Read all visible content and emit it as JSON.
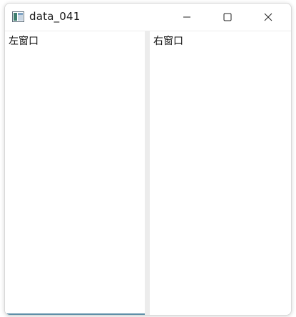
{
  "window": {
    "title": "data_041"
  },
  "titlebar": {
    "buttons": {
      "minimize": "minimize-icon",
      "maximize": "maximize-icon",
      "close": "close-icon"
    }
  },
  "panes": {
    "left": {
      "text": "左窗口"
    },
    "right": {
      "text": "右窗口"
    }
  },
  "colors": {
    "accent_bottom": "#5f8fa8",
    "splitter": "#ececec"
  }
}
